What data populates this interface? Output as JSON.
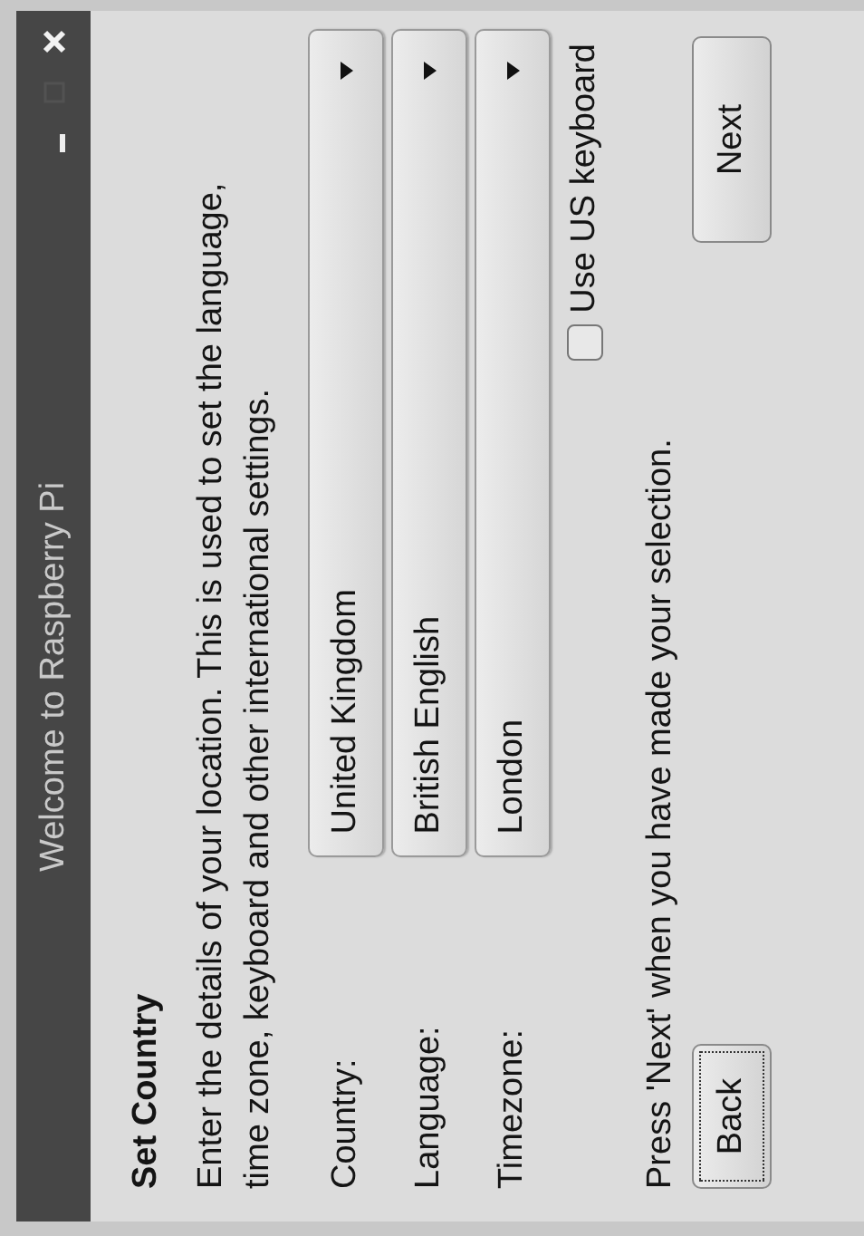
{
  "window": {
    "title": "Welcome to Raspberry Pi"
  },
  "heading": "Set Country",
  "description": [
    "Enter the details of your location. This is used to set the language,",
    "time zone, keyboard and other international settings."
  ],
  "fields": [
    {
      "label": "Country:",
      "value": "United Kingdom"
    },
    {
      "label": "Language:",
      "value": "British English"
    },
    {
      "label": "Timezone:",
      "value": "London"
    }
  ],
  "checkbox": {
    "label": "Use US keyboard",
    "checked": false
  },
  "hint": "Press 'Next' when you have made your selection.",
  "buttons": [
    {
      "label": "Back",
      "focused": true
    },
    {
      "label": "Next",
      "focused": false
    }
  ]
}
